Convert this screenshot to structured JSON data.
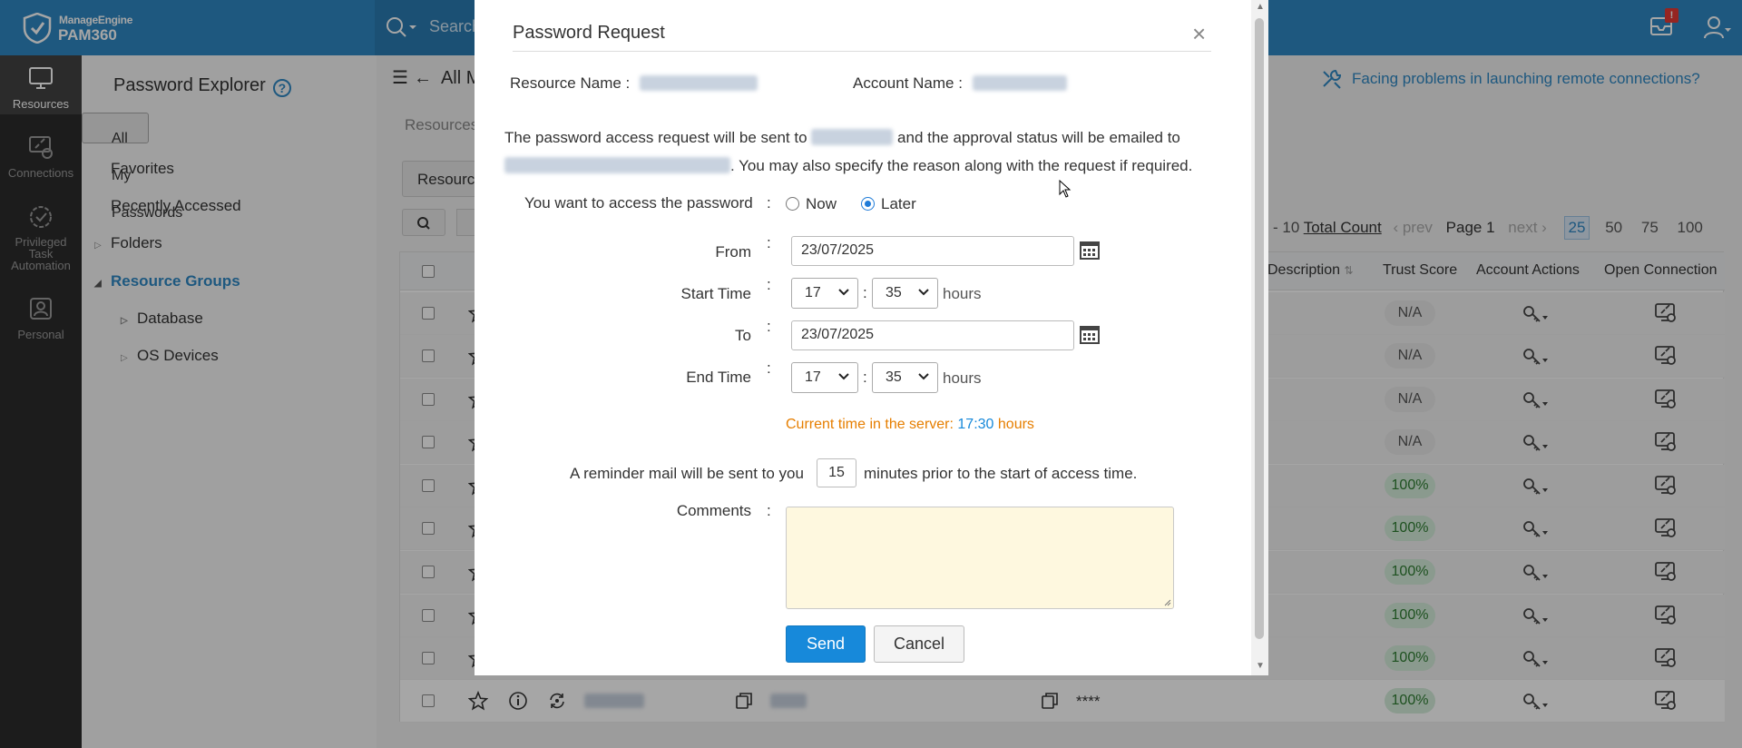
{
  "topbar": {
    "brand_small": "ManageEngine",
    "brand_main": "PAM360",
    "search_label": "Search",
    "notification_badge": "!"
  },
  "nav": {
    "items": [
      {
        "label": "Resources",
        "icon": "monitor-icon",
        "active": true
      },
      {
        "label": "Connections",
        "icon": "connections-icon",
        "active": false
      },
      {
        "label": "Privileged Task Automation",
        "icon": "task-check-icon",
        "active": false
      },
      {
        "label": "Personal",
        "icon": "personal-id-icon",
        "active": false
      }
    ]
  },
  "panel": {
    "title": "Password Explorer",
    "items": [
      {
        "label": "All My Passwords"
      },
      {
        "label": "Favorites"
      },
      {
        "label": "Recently Accessed"
      },
      {
        "label": "Folders"
      },
      {
        "label": "Resource Groups"
      },
      {
        "label": "Database"
      },
      {
        "label": "OS Devices"
      }
    ]
  },
  "main": {
    "breadcrumb": "All M",
    "facing_link": "Facing problems in launching remote connections?",
    "resources_tab": "Resources",
    "resource_button": "Resource",
    "pager": {
      "range": "- 10",
      "total_count": "Total Count",
      "prev": "prev",
      "page": "Page 1",
      "next": "next",
      "sizes": [
        "25",
        "50",
        "75",
        "100"
      ]
    },
    "columns": {
      "description": "Description",
      "trust_score": "Trust Score",
      "account_actions": "Account Actions",
      "open_connection": "Open Connection"
    },
    "rows": [
      {
        "trust": "N/A"
      },
      {
        "trust": "N/A"
      },
      {
        "trust": "N/A"
      },
      {
        "trust": "N/A"
      },
      {
        "trust": "100%"
      },
      {
        "trust": "100%"
      },
      {
        "trust": "100%"
      },
      {
        "trust": "100%"
      },
      {
        "trust": "100%"
      },
      {
        "trust": "100%",
        "password_mask": "****"
      }
    ]
  },
  "modal": {
    "title": "Password Request",
    "close": "×",
    "resource_name_label": "Resource Name :",
    "account_name_label": "Account Name :",
    "msg_part1": "The password access request will be sent to",
    "msg_part2": "and the approval status will be emailed to",
    "msg_part3": ". You may also specify the reason along with the request if required.",
    "access_label": "You want to access the password",
    "colon": ":",
    "option_now": "Now",
    "option_later": "Later",
    "from_label": "From",
    "from_value": "23/07/2025",
    "start_time_label": "Start Time",
    "start_hour": "17",
    "start_minute": "35",
    "to_label": "To",
    "to_value": "23/07/2025",
    "end_time_label": "End Time",
    "end_hour": "17",
    "end_minute": "35",
    "hours": "hours",
    "time_sep": ":",
    "server_time_prefix": "Current time in the server:",
    "server_time": "17:30",
    "server_time_suffix": "hours",
    "reminder_prefix": "A reminder mail will be sent to you",
    "reminder_minutes": "15",
    "reminder_suffix": "minutes prior to the start of access time.",
    "comments_label": "Comments",
    "send": "Send",
    "cancel": "Cancel"
  },
  "colors": {
    "topbar": "#2e88c4",
    "nav": "#2c2c2c",
    "accent": "#1789da",
    "server_time_orange": "#e67e00",
    "comments_bg": "#fef8df"
  }
}
